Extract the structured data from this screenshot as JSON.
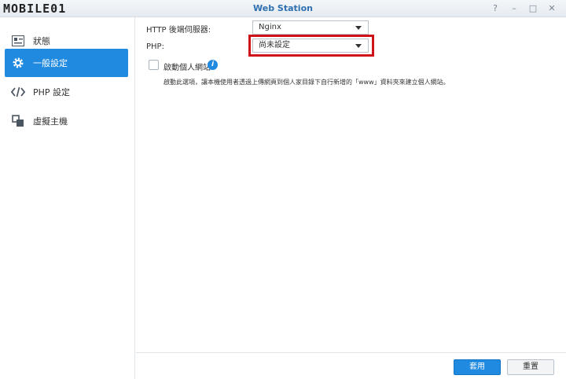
{
  "window": {
    "title": "Web Station",
    "watermark": "MOBILE01",
    "controls": [
      "?",
      "–",
      "□",
      "✕"
    ]
  },
  "sidebar": {
    "items": [
      {
        "label": "狀態",
        "icon": "status-card-icon",
        "active": false
      },
      {
        "label": "一般設定",
        "icon": "gear-icon",
        "active": true
      },
      {
        "label": "PHP 設定",
        "icon": "code-icon",
        "active": false
      },
      {
        "label": "虛擬主機",
        "icon": "virtual-host-icon",
        "active": false
      }
    ]
  },
  "general": {
    "http_label": "HTTP 後端伺服器:",
    "http_value": "Nginx",
    "php_label": "PHP:",
    "php_value": "尚未設定",
    "personal_site_label": "啟動個人網站",
    "personal_site_checked": false,
    "description": "啟動此選項，讓本機使用者透過上傳網頁到個人家目錄下自行新增的「www」資料夾來建立個人網站。"
  },
  "footer": {
    "apply_label": "套用",
    "reset_label": "重置"
  },
  "colors": {
    "accent": "#1f8ae0",
    "title": "#2d6fb0",
    "highlight": "#d0121b"
  }
}
